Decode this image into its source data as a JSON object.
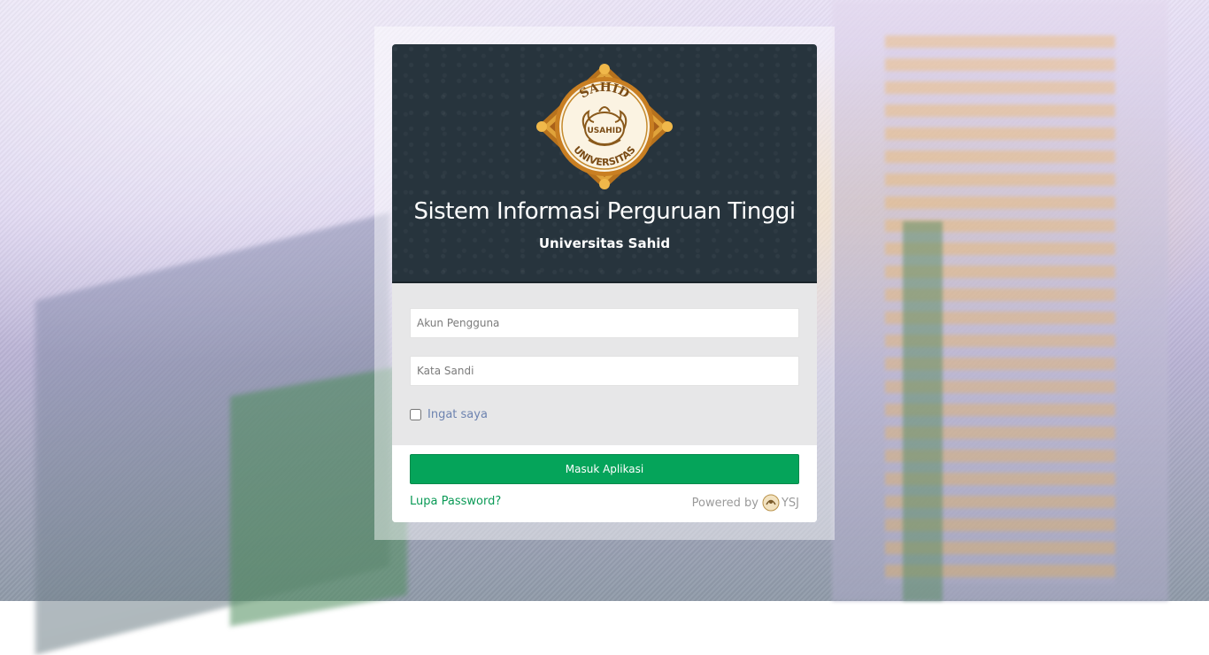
{
  "app": {
    "title": "Sistem Informasi Perguruan Tinggi",
    "subtitle": "Universitas Sahid"
  },
  "logo": {
    "top_text": "SAHID",
    "center_text": "USAHID",
    "bottom_text": "UNIVERSITAS"
  },
  "login": {
    "username_placeholder": "Akun Pengguna",
    "password_placeholder": "Kata Sandi",
    "remember_label": "Ingat saya",
    "remember_checked": false,
    "submit_label": "Masuk Aplikasi",
    "forgot_label": "Lupa Password?"
  },
  "footer": {
    "powered_label": "Powered by",
    "vendor": "YSJ",
    "vendor_icon": "ysj-logo-icon"
  },
  "colors": {
    "header_bg": "#27343d",
    "primary_button": "#05a45a",
    "link": "#0a9a56",
    "form_bg": "#e7e7e8"
  }
}
